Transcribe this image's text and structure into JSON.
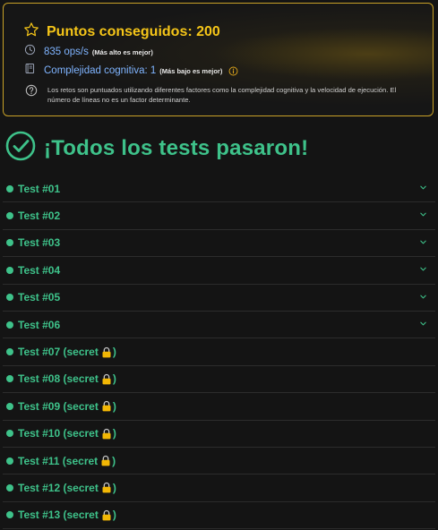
{
  "score": {
    "points_label": "Puntos conseguidos: 200",
    "ops_value": "835 ops/s",
    "ops_note": "(Más alto es mejor)",
    "complexity_value": "Complejidad cognitiva: 1",
    "complexity_note": "(Más bajo es mejor)",
    "description": "Los retos son puntuados utilizando diferentes factores como la complejidad cognitiva y la velocidad de ejecución. El número de líneas no es un factor determinante."
  },
  "result": {
    "title": "¡Todos los tests pasaron!"
  },
  "tests": [
    {
      "label": "Test #01",
      "secret": false
    },
    {
      "label": "Test #02",
      "secret": false
    },
    {
      "label": "Test #03",
      "secret": false
    },
    {
      "label": "Test #04",
      "secret": false
    },
    {
      "label": "Test #05",
      "secret": false
    },
    {
      "label": "Test #06",
      "secret": false
    },
    {
      "label": "Test #07 (secret",
      "secret": true
    },
    {
      "label": "Test #08 (secret",
      "secret": true
    },
    {
      "label": "Test #09 (secret",
      "secret": true
    },
    {
      "label": "Test #10 (secret",
      "secret": true
    },
    {
      "label": "Test #11 (secret",
      "secret": true
    },
    {
      "label": "Test #12 (secret",
      "secret": true
    },
    {
      "label": "Test #13 (secret",
      "secret": true
    }
  ],
  "colors": {
    "accent_green": "#3ec28a",
    "gold": "#f5c518",
    "stat_blue": "#7fb4ff"
  },
  "icons": {
    "points": "star-icon",
    "ops": "clock-icon",
    "complexity": "document-icon",
    "info": "info-icon",
    "help": "help-circle-icon",
    "success": "check-circle-icon",
    "expand": "chevron-down-icon",
    "secret": "lock-icon"
  }
}
